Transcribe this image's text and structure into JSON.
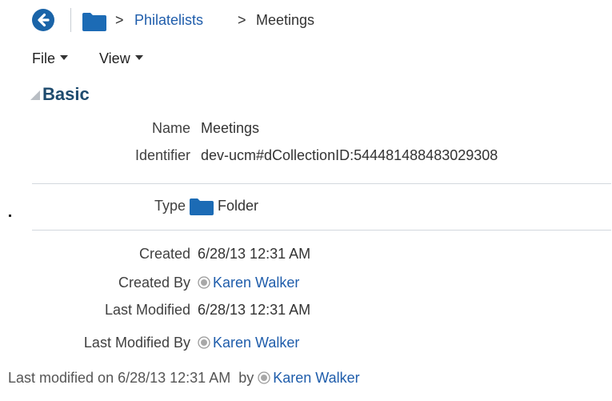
{
  "breadcrumb": {
    "separator": ">",
    "items": [
      {
        "label": "Philatelists"
      },
      {
        "label": "Meetings"
      }
    ]
  },
  "menus": [
    {
      "label": "File"
    },
    {
      "label": "View"
    }
  ],
  "section": {
    "title": "Basic"
  },
  "fields": {
    "name": {
      "label": "Name",
      "value": "Meetings"
    },
    "identifier": {
      "label": "Identifier",
      "value": "dev-ucm#dCollectionID:544481488483029308"
    },
    "type": {
      "label": "Type",
      "value": "Folder"
    },
    "created": {
      "label": "Created",
      "value": "6/28/13 12:31 AM"
    },
    "created_by": {
      "label": "Created By",
      "value": "Karen Walker"
    },
    "last_modified": {
      "label": "Last Modified",
      "value": "6/28/13 12:31 AM"
    },
    "last_modified_by": {
      "label": "Last Modified By",
      "value": "Karen Walker"
    }
  },
  "footer": {
    "prefix": "Last modified on 6/28/13 12:31 AM  by",
    "user": "Karen Walker"
  },
  "colors": {
    "accent": "#1a64a8",
    "link": "#1f5dab",
    "folder": "#1c6bb5",
    "section_title": "#1e4b6e"
  }
}
